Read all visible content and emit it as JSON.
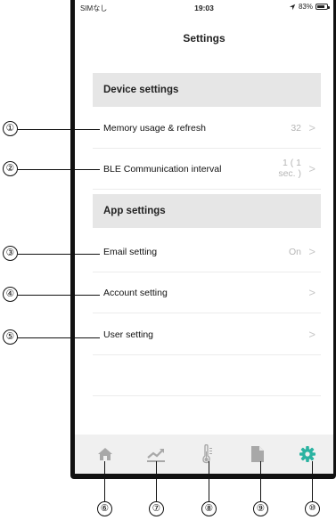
{
  "status_bar": {
    "carrier": "SIMなし",
    "time": "19:03",
    "battery": "83%",
    "battery_level": 0.83
  },
  "nav": {
    "title": "Settings"
  },
  "sections": {
    "device": {
      "header": "Device settings",
      "rows": [
        {
          "label": "Memory usage & refresh",
          "value": "32"
        },
        {
          "label": "BLE Communication interval",
          "value": "1 ( 1 sec. )"
        }
      ]
    },
    "app": {
      "header": "App settings",
      "rows": [
        {
          "label": "Email setting",
          "value": "On"
        },
        {
          "label": "Account setting",
          "value": ""
        },
        {
          "label": "User setting",
          "value": ""
        }
      ]
    }
  },
  "chevron": ">",
  "tabs": [
    {
      "name": "home",
      "icon": "home-icon",
      "active": false
    },
    {
      "name": "graph",
      "icon": "trend-graph-icon",
      "active": false
    },
    {
      "name": "temperature",
      "icon": "thermometer-icon",
      "active": false
    },
    {
      "name": "document",
      "icon": "document-icon",
      "active": false
    },
    {
      "name": "settings",
      "icon": "gear-icon",
      "active": true
    }
  ],
  "colors": {
    "active_tab": "#2bb3a1",
    "inactive_tab": "#a8a8a8",
    "section_header_bg": "#e6e6e6",
    "value_text": "#b5b5b5"
  },
  "callouts": [
    "①",
    "②",
    "③",
    "④",
    "⑤",
    "⑥",
    "⑦",
    "⑧",
    "⑨",
    "⑩"
  ]
}
